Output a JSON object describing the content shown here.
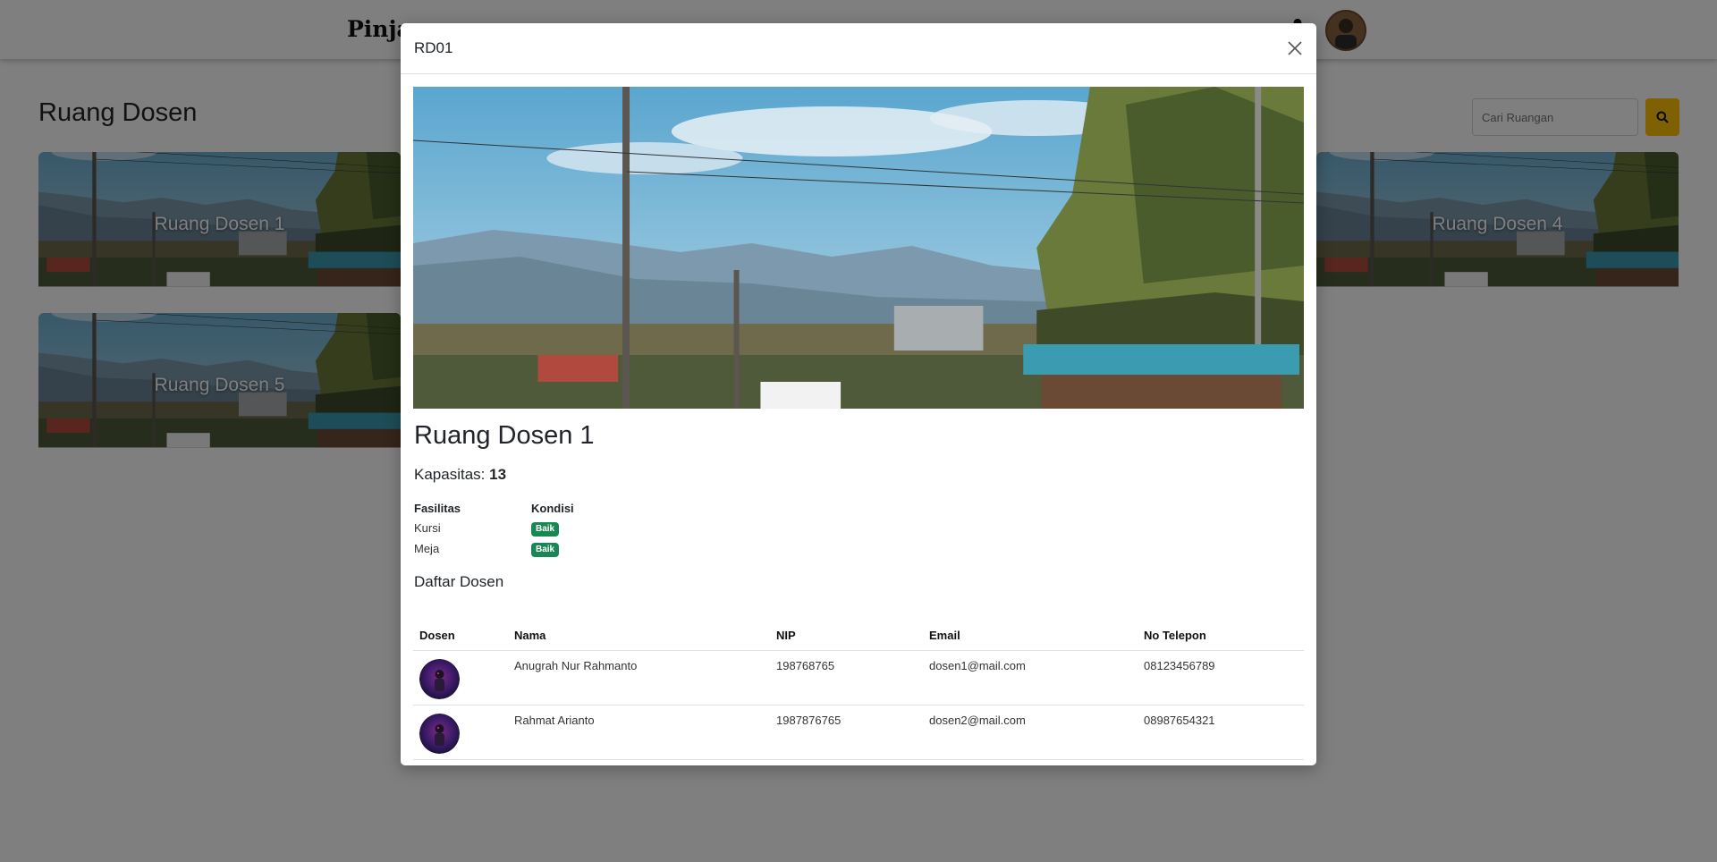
{
  "navbar": {
    "brand": "Pinjam",
    "bell_icon": "bell-icon",
    "avatar_icon": "user-avatar"
  },
  "page": {
    "title": "Ruang Dosen",
    "search": {
      "placeholder": "Cari Ruangan",
      "icon": "search-icon"
    },
    "rooms": [
      {
        "label": "Ruang Dosen 1"
      },
      {
        "label": "Ruang Dosen 4"
      },
      {
        "label": "Ruang Dosen 5"
      }
    ]
  },
  "modal": {
    "title": "RD01",
    "close_icon": "close-icon",
    "room_name": "Ruang Dosen 1",
    "capacity_label": "Kapasitas:",
    "capacity_value": "13",
    "facilities": {
      "headers": [
        "Fasilitas",
        "Kondisi"
      ],
      "rows": [
        {
          "name": "Kursi",
          "condition": "Baik"
        },
        {
          "name": "Meja",
          "condition": "Baik"
        }
      ]
    },
    "lecturers_title": "Daftar Dosen",
    "lecturers": {
      "headers": [
        "Dosen",
        "Nama",
        "NIP",
        "Email",
        "No Telepon"
      ],
      "rows": [
        {
          "name": "Anugrah Nur Rahmanto",
          "nip": "198768765",
          "email": "dosen1@mail.com",
          "phone": "08123456789"
        },
        {
          "name": "Rahmat Arianto",
          "nip": "1987876765",
          "email": "dosen2@mail.com",
          "phone": "08987654321"
        }
      ]
    }
  },
  "colors": {
    "accent": "#ffc107",
    "badge": "#198754",
    "backdrop": "rgba(0,0,0,0.5)"
  }
}
